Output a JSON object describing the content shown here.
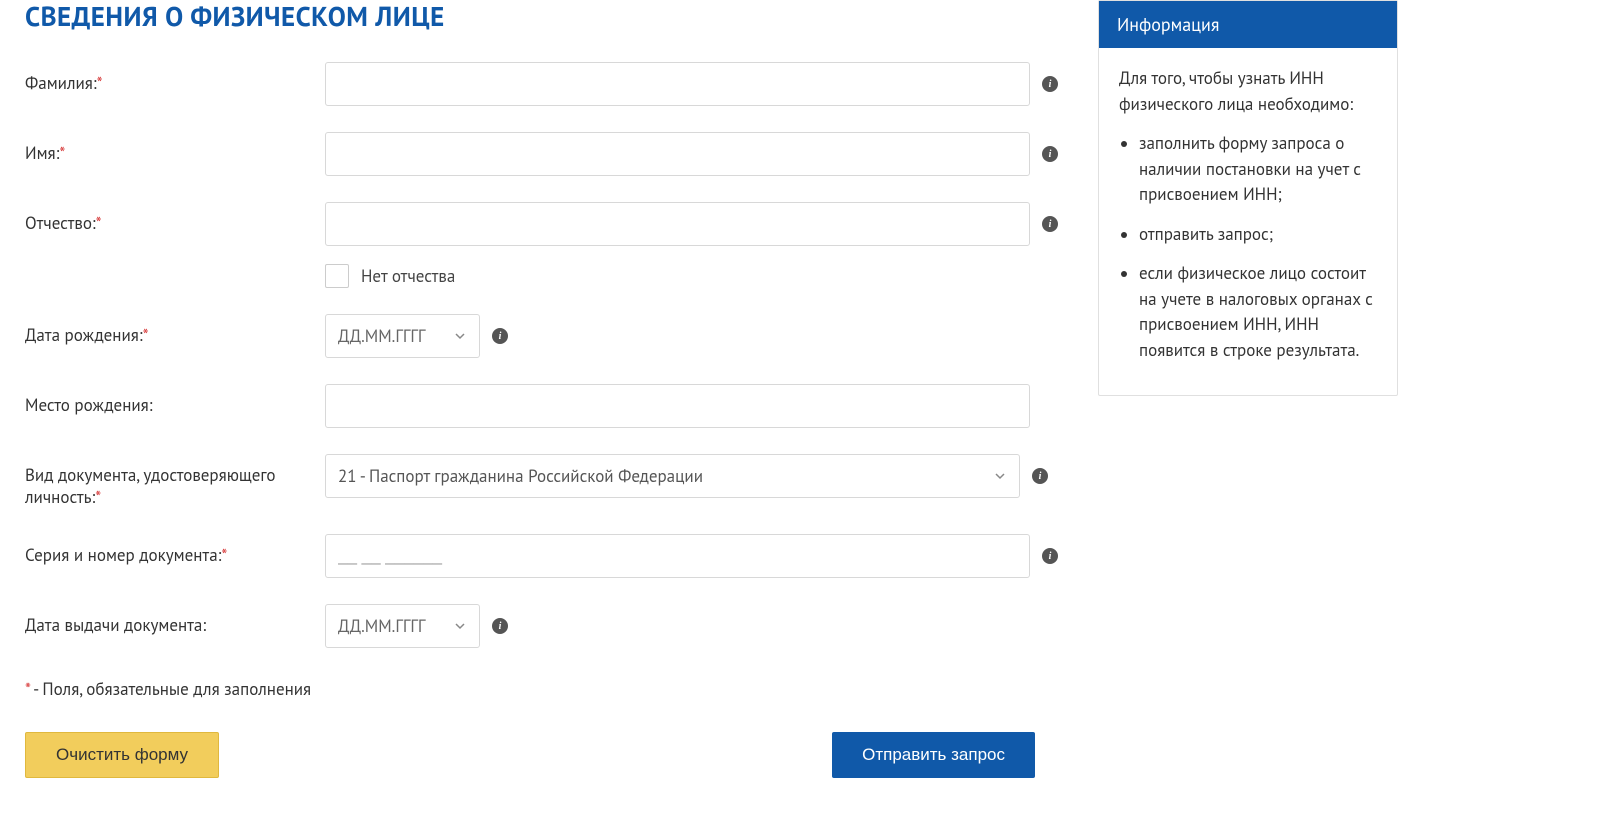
{
  "title": "СВЕДЕНИЯ О ФИЗИЧЕСКОМ ЛИЦЕ",
  "labels": {
    "surname": "Фамилия:",
    "name": "Имя:",
    "patronymic": "Отчество:",
    "no_patronymic": "Нет отчества",
    "birth_date": "Дата рождения:",
    "birth_place": "Место рождения:",
    "doc_type": "Вид документа, удостоверяющего личность:",
    "doc_number": "Серия и номер документа:",
    "doc_date": "Дата выдачи документа:"
  },
  "placeholders": {
    "date": "ДД.ММ.ГГГГ",
    "doc_number": "__ __ ______"
  },
  "doc_type_value": "21 - Паспорт гражданина Российской Федерации",
  "note_prefix": "*",
  "note_text": " - Поля, обязательные для заполнения",
  "buttons": {
    "clear": "Очистить форму",
    "submit": "Отправить запрос"
  },
  "info_panel": {
    "title": "Информация",
    "intro": "Для того, чтобы узнать ИНН физического лица необходимо:",
    "items": [
      "заполнить форму запроса о наличии постановки на учет с присвоением ИНН;",
      "отправить запрос;",
      "если физическое лицо состоит на учете в налоговых органах с присвоением ИНН, ИНН появится в строке результата."
    ]
  }
}
